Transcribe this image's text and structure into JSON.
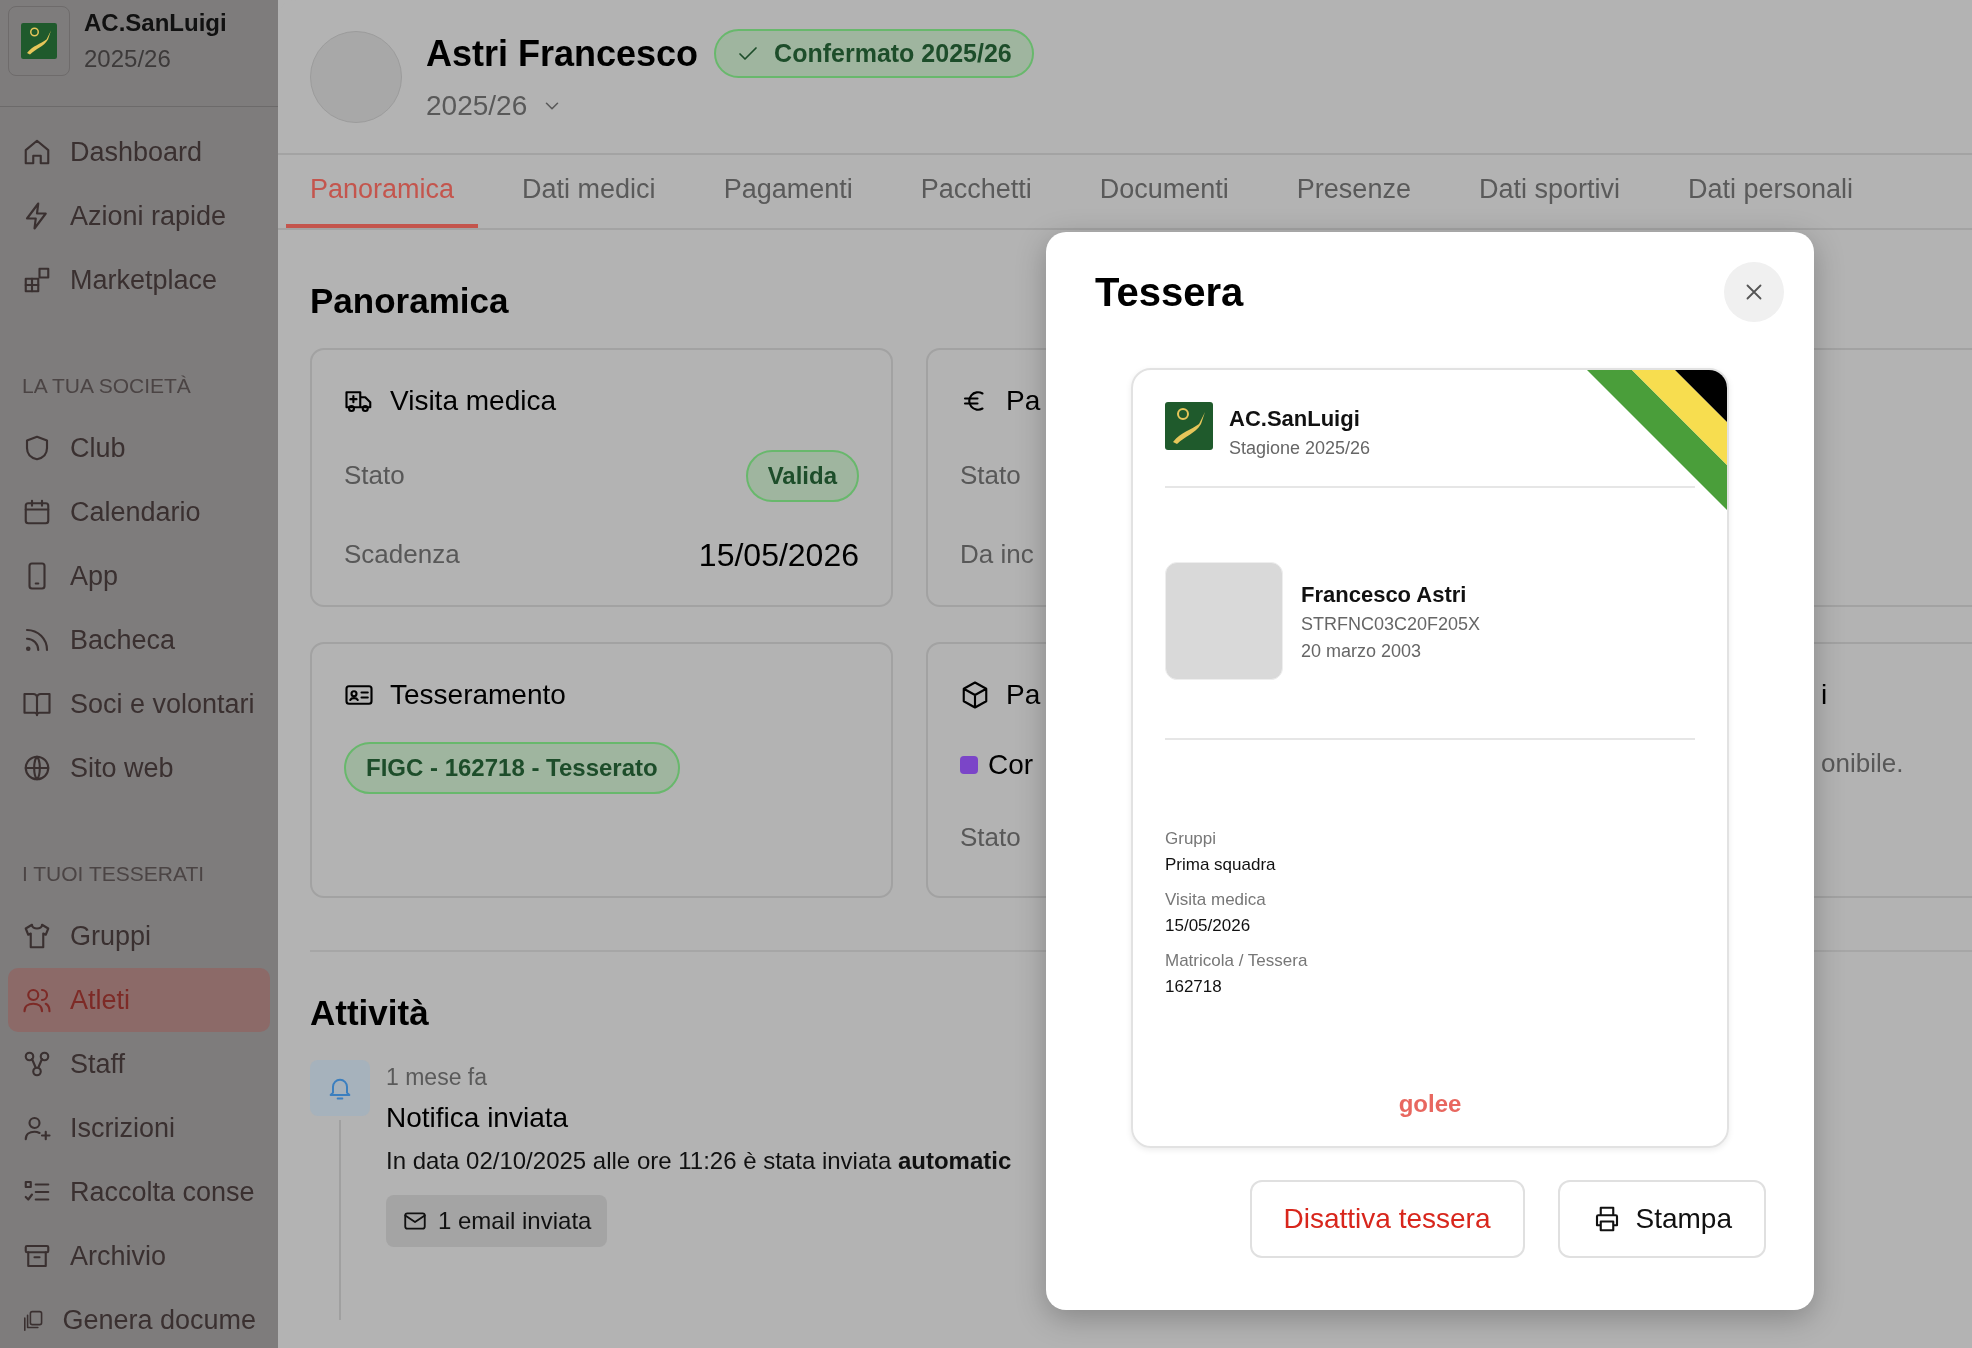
{
  "sidebar": {
    "club_name": "AC.SanLuigi",
    "season": "2025/26",
    "sections": [
      {
        "items": [
          {
            "label": "Dashboard",
            "selected": false
          },
          {
            "label": "Azioni rapide",
            "selected": false
          },
          {
            "label": "Marketplace",
            "selected": false
          }
        ]
      },
      {
        "heading": "LA TUA SOCIETÀ",
        "items": [
          {
            "label": "Club",
            "selected": false
          },
          {
            "label": "Calendario",
            "selected": false
          },
          {
            "label": "App",
            "selected": false
          },
          {
            "label": "Bacheca",
            "selected": false
          },
          {
            "label": "Soci e volontari",
            "selected": false
          },
          {
            "label": "Sito web",
            "selected": false
          }
        ]
      },
      {
        "heading": "I TUOI TESSERATI",
        "items": [
          {
            "label": "Gruppi",
            "selected": false
          },
          {
            "label": "Atleti",
            "selected": true
          },
          {
            "label": "Staff",
            "selected": false
          },
          {
            "label": "Iscrizioni",
            "selected": false
          },
          {
            "label": "Raccolta conse",
            "selected": false
          },
          {
            "label": "Archivio",
            "selected": false
          },
          {
            "label": "Genera docume",
            "selected": false
          }
        ]
      }
    ]
  },
  "header": {
    "name": "Astri Francesco",
    "status_badge": "Confermato 2025/26",
    "season": "2025/26"
  },
  "tabs": [
    {
      "label": "Panoramica",
      "selected": true
    },
    {
      "label": "Dati medici",
      "selected": false
    },
    {
      "label": "Pagamenti",
      "selected": false
    },
    {
      "label": "Pacchetti",
      "selected": false
    },
    {
      "label": "Documenti",
      "selected": false
    },
    {
      "label": "Presenze",
      "selected": false
    },
    {
      "label": "Dati sportivi",
      "selected": false
    },
    {
      "label": "Dati personali",
      "selected": false
    }
  ],
  "overview": {
    "title": "Panoramica",
    "cards": [
      {
        "kind": "rows",
        "title": "Visita medica",
        "rows": [
          {
            "label": "Stato",
            "badge": "Valida"
          },
          {
            "label": "Scadenza",
            "value": "15/05/2026"
          }
        ]
      },
      {
        "kind": "rows",
        "title": "Pa",
        "rows": [
          {
            "label": "Stato"
          },
          {
            "label": "Da inc"
          }
        ]
      },
      {
        "kind": "empty"
      },
      {
        "kind": "badge",
        "title": "Tesseramento",
        "badge": "FIGC - 162718 - Tesserato"
      },
      {
        "kind": "package",
        "title": "Pa",
        "package": {
          "name": "Cor",
          "color": "#7b45c8"
        },
        "rows": [
          {
            "label": "Stato"
          }
        ]
      },
      {
        "kind": "tail",
        "title": "i",
        "text": "onibile."
      }
    ]
  },
  "activity": {
    "title": "Attività",
    "items": [
      {
        "time": "1 mese fa",
        "title": "Notifica inviata",
        "text": "In data 02/10/2025 alle ore 11:26 è stata inviata **automatic**",
        "chip": "1 email inviata"
      }
    ]
  },
  "modal": {
    "title": "Tessera",
    "card": {
      "club": "AC.SanLuigi",
      "season": "Stagione 2025/26",
      "member": {
        "name": "Francesco Astri",
        "tax_code": "STRFNC03C20F205X",
        "birth_date": "20 marzo 2003"
      },
      "fields": [
        {
          "label": "Gruppi",
          "value": "Prima squadra"
        },
        {
          "label": "Visita medica",
          "value": "15/05/2026"
        },
        {
          "label": "Matricola / Tessera",
          "value": "162718"
        }
      ],
      "brand": "golee"
    },
    "buttons": [
      {
        "label": "Disattiva tessera",
        "kind": "danger"
      },
      {
        "label": "Stampa",
        "kind": "print"
      }
    ]
  }
}
